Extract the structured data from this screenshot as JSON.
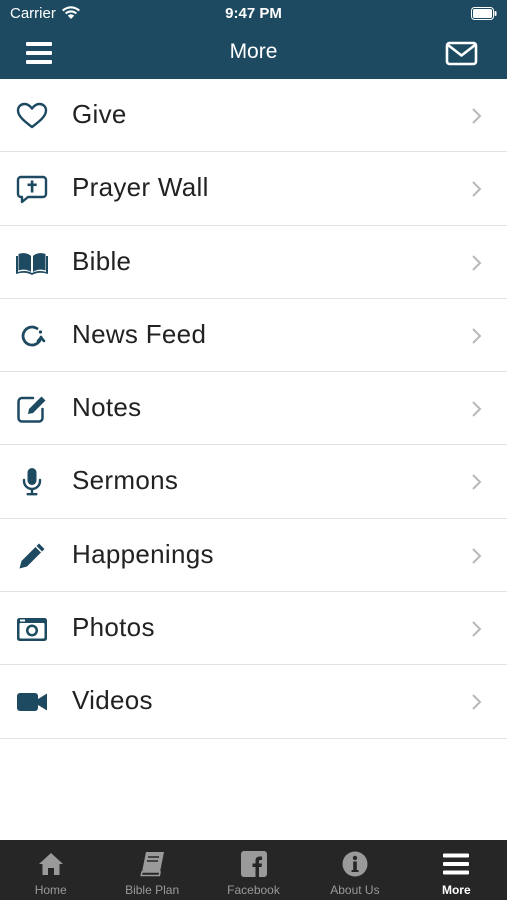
{
  "status_bar": {
    "carrier": "Carrier",
    "time": "9:47 PM"
  },
  "nav": {
    "title": "More",
    "left_icon": "hamburger-menu-icon",
    "right_icon": "mail-icon"
  },
  "colors": {
    "primary": "#1d4a60",
    "tab_bar": "#262626",
    "tab_inactive": "#9a9a9a",
    "tab_active": "#ffffff"
  },
  "menu": {
    "items": [
      {
        "label": "Give",
        "icon": "heart-icon"
      },
      {
        "label": "Prayer Wall",
        "icon": "prayer-wall-icon"
      },
      {
        "label": "Bible",
        "icon": "open-book-icon"
      },
      {
        "label": "News Feed",
        "icon": "news-feed-icon"
      },
      {
        "label": "Notes",
        "icon": "edit-note-icon"
      },
      {
        "label": "Sermons",
        "icon": "microphone-icon"
      },
      {
        "label": "Happenings",
        "icon": "pencil-icon"
      },
      {
        "label": "Photos",
        "icon": "camera-icon"
      },
      {
        "label": "Videos",
        "icon": "video-camera-icon"
      }
    ]
  },
  "tab_bar": {
    "tabs": [
      {
        "label": "Home",
        "icon": "home-icon",
        "active": false
      },
      {
        "label": "Bible Plan",
        "icon": "book-icon",
        "active": false
      },
      {
        "label": "Facebook",
        "icon": "facebook-icon",
        "active": false
      },
      {
        "label": "About Us",
        "icon": "info-icon",
        "active": false
      },
      {
        "label": "More",
        "icon": "hamburger-menu-icon",
        "active": true
      }
    ]
  }
}
